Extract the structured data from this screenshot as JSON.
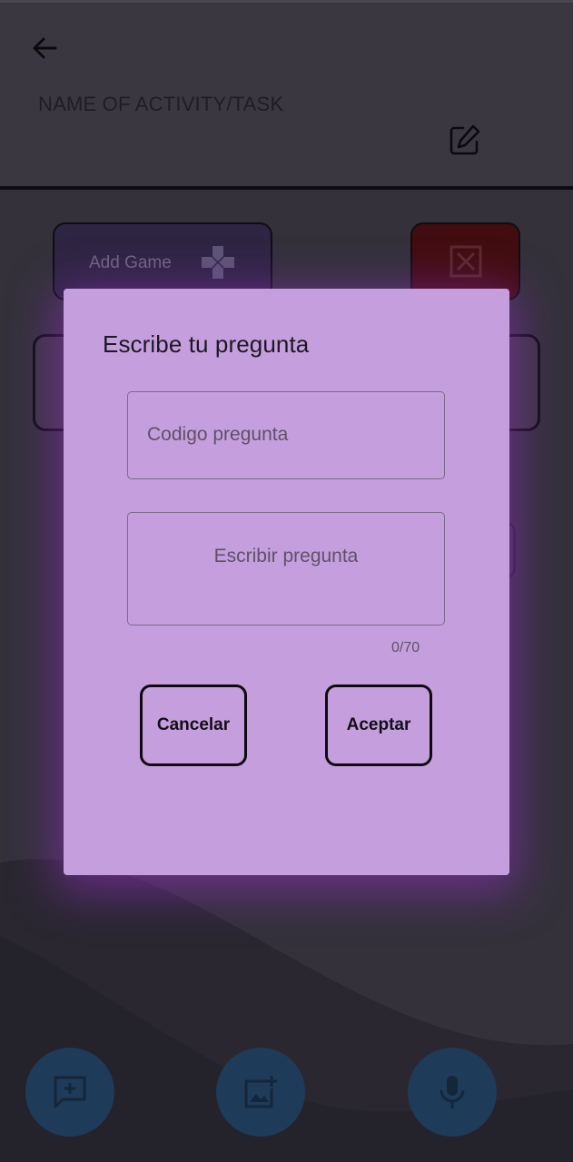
{
  "header": {
    "title": "NAME OF ACTIVITY/TASK"
  },
  "content": {
    "add_game_label": "Add Game"
  },
  "dialog": {
    "title": "Escribe tu pregunta",
    "code_placeholder": "Codigo pregunta",
    "question_placeholder": "Escribir  pregunta",
    "counter": "0/70",
    "cancel_label": "Cancelar",
    "accept_label": "Aceptar"
  },
  "icons": {
    "back": "arrow-left-icon",
    "edit": "edit-icon",
    "game": "gamepad-icon",
    "close": "close-box-icon",
    "add_comment": "add-comment-icon",
    "add_image": "add-image-icon",
    "mic": "mic-icon"
  },
  "colors": {
    "background": "#34313b",
    "dialog": "#c59fdd",
    "fab": "#1f3b5a",
    "add_game_card": "#2e2542",
    "close_card": "#420d10"
  }
}
